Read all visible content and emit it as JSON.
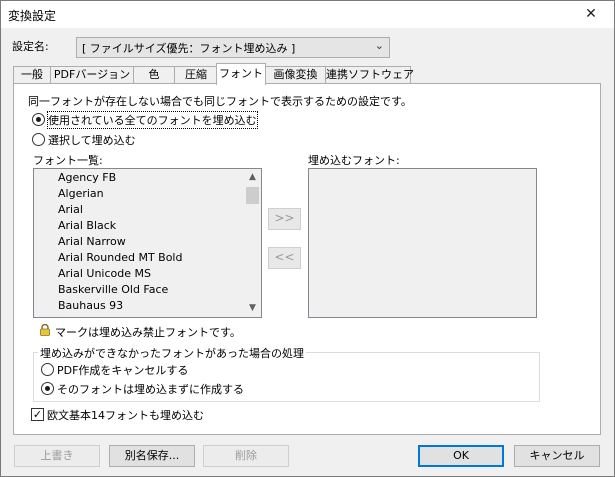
{
  "window": {
    "title": "変換設定",
    "close": "✕"
  },
  "settings": {
    "label": "設定名:",
    "value": "[ ファイルサイズ優先：フォント埋め込み ]"
  },
  "tabs": [
    {
      "label": "一般"
    },
    {
      "label": "PDFバージョン"
    },
    {
      "label": "色"
    },
    {
      "label": "圧縮"
    },
    {
      "label": "フォント"
    },
    {
      "label": "画像変換"
    },
    {
      "label": "連携ソフトウェア"
    }
  ],
  "font_tab": {
    "description": "同一フォントが存在しない場合でも同じフォントで表示するための設定です。",
    "embed_all": "使用されている全てのフォントを埋め込む",
    "embed_selected": "選択して埋め込む",
    "font_list_label": "フォント一覧:",
    "embed_list_label": "埋め込むフォント:",
    "fonts": [
      "Agency FB",
      "Algerian",
      "Arial",
      "Arial Black",
      "Arial Narrow",
      "Arial Rounded MT Bold",
      "Arial Unicode MS",
      "Baskerville Old Face",
      "Bauhaus 93"
    ],
    "add_arrow": ">>",
    "remove_arrow": "<<",
    "lock_note": "マークは埋め込み禁止フォントです。",
    "fail_group_title": "埋め込みができなかったフォントがあった場合の処理",
    "fail_cancel": "PDF作成をキャンセルする",
    "fail_continue": "そのフォントは埋め込まずに作成する",
    "base14": "欧文基本14フォントも埋め込む"
  },
  "buttons": {
    "overwrite": "上書き",
    "save_as": "別名保存...",
    "delete": "削除",
    "ok": "OK",
    "cancel": "キャンセル"
  },
  "state": {
    "active_tab": "フォント",
    "embed_mode": "embed_all",
    "fail_mode": "continue",
    "base14_checked": true
  }
}
